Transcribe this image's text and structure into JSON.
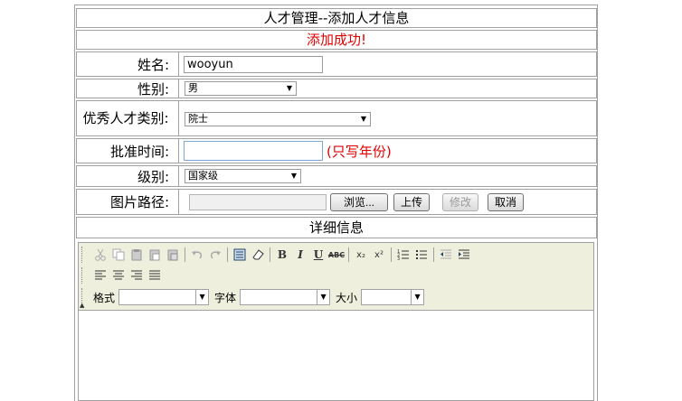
{
  "header": {
    "title": "人才管理--添加人才信息",
    "message": "添加成功!"
  },
  "form": {
    "name_label": "姓名:",
    "name_value": "wooyun",
    "gender_label": "性别:",
    "gender_value": "男",
    "category_label": "优秀人才类别:",
    "category_value": "院士",
    "approve_label": "批准时间:",
    "approve_value": "",
    "approve_hint": "(只写年份)",
    "level_label": "级别:",
    "level_value": "国家级",
    "image_label": "图片路径:",
    "browse_label": "浏览...",
    "upload_label": "上传",
    "modify_label": "修改",
    "cancel_label": "取消"
  },
  "details": {
    "title": "详细信息"
  },
  "editor": {
    "format_label": "格式",
    "font_label": "字体",
    "size_label": "大小",
    "icons": [
      "cut-icon",
      "copy-icon",
      "paste-icon",
      "paste-text-icon",
      "paste-word-icon",
      "undo-icon",
      "redo-icon",
      "select-all-icon",
      "remove-format-icon",
      "bold-icon",
      "italic-icon",
      "underline-icon",
      "strike-icon",
      "subscript-icon",
      "superscript-icon",
      "ordered-list-icon",
      "unordered-list-icon",
      "outdent-icon",
      "indent-icon",
      "align-left-icon",
      "align-center-icon",
      "align-right-icon",
      "justify-icon"
    ]
  },
  "glyphs": {
    "bold": "B",
    "italic": "I",
    "underline": "U",
    "strike": "ABC",
    "subscript": "x₂",
    "superscript": "x²",
    "collapse": "▲",
    "arrow": "▼"
  }
}
